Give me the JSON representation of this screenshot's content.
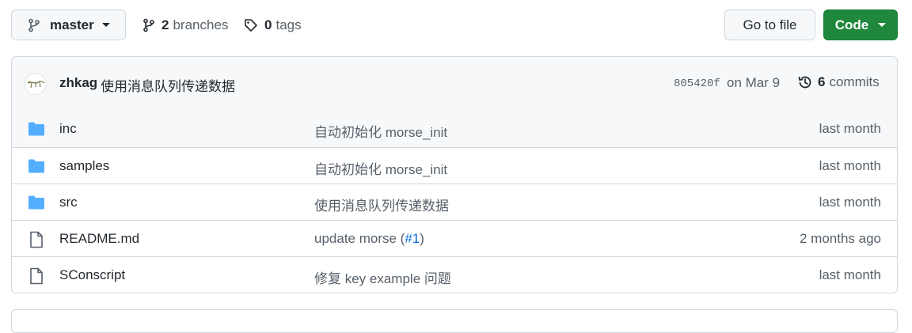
{
  "branch": {
    "name": "master"
  },
  "meta": {
    "branches_count": "2",
    "branches_label": "branches",
    "tags_count": "0",
    "tags_label": "tags"
  },
  "actions": {
    "goto_file": "Go to file",
    "code": "Code"
  },
  "commit": {
    "author": "zhkag",
    "message": "使用消息队列传递数据",
    "sha": "805420f",
    "date": "on Mar 9",
    "commits_count": "6",
    "commits_label": "commits"
  },
  "files": [
    {
      "type": "folder",
      "name": "inc",
      "message": "自动初始化 morse_init",
      "age": "last month"
    },
    {
      "type": "folder",
      "name": "samples",
      "message": "自动初始化 morse_init",
      "age": "last month"
    },
    {
      "type": "folder",
      "name": "src",
      "message": "使用消息队列传递数据",
      "age": "last month"
    },
    {
      "type": "file",
      "name": "README.md",
      "message": "update morse (",
      "message_ref": "#1",
      "message_end": ")",
      "age": "2 months ago"
    },
    {
      "type": "file",
      "name": "SConscript",
      "message": "修复 key example 问题",
      "age": "last month"
    }
  ],
  "colors": {
    "accent_green": "#1f883d",
    "folder_blue": "#54aeff",
    "link_blue": "#0969da"
  }
}
